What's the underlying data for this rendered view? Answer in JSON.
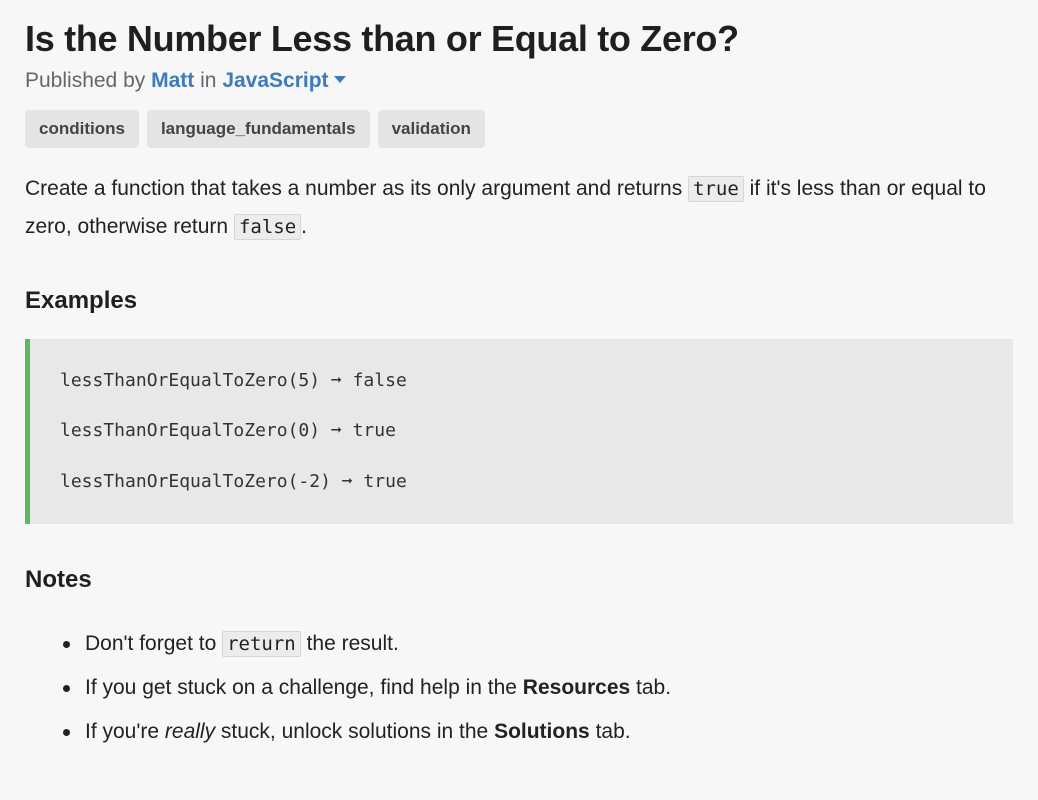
{
  "challenge": {
    "title": "Is the Number Less than or Equal to Zero?",
    "published_by_label": "Published by",
    "author": "Matt",
    "in_label": "in",
    "language": "JavaScript",
    "tags": [
      "conditions",
      "language_fundamentals",
      "validation"
    ],
    "description": {
      "part1": "Create a function that takes a number as its only argument and returns ",
      "code1": "true",
      "part2": " if it's less than or equal to zero, otherwise return ",
      "code2": "false",
      "part3": "."
    }
  },
  "examples": {
    "heading": "Examples",
    "lines": [
      "lessThanOrEqualToZero(5) ➞ false",
      "lessThanOrEqualToZero(0) ➞ true",
      "lessThanOrEqualToZero(-2) ➞ true"
    ]
  },
  "notes": {
    "heading": "Notes",
    "item1": {
      "before": "Don't forget to ",
      "code": "return",
      "after": " the result."
    },
    "item2": {
      "before": "If you get stuck on a challenge, find help in the ",
      "bold": "Resources",
      "after": " tab."
    },
    "item3": {
      "before": "If you're ",
      "italic": "really",
      "middle": " stuck, unlock solutions in the ",
      "bold": "Solutions",
      "after": " tab."
    }
  },
  "colors": {
    "link": "#3b7bc4",
    "code_border_accent": "#5cb85c",
    "background": "#f7f7f7"
  },
  "icons": {
    "language_dropdown": "caret-down-icon"
  }
}
